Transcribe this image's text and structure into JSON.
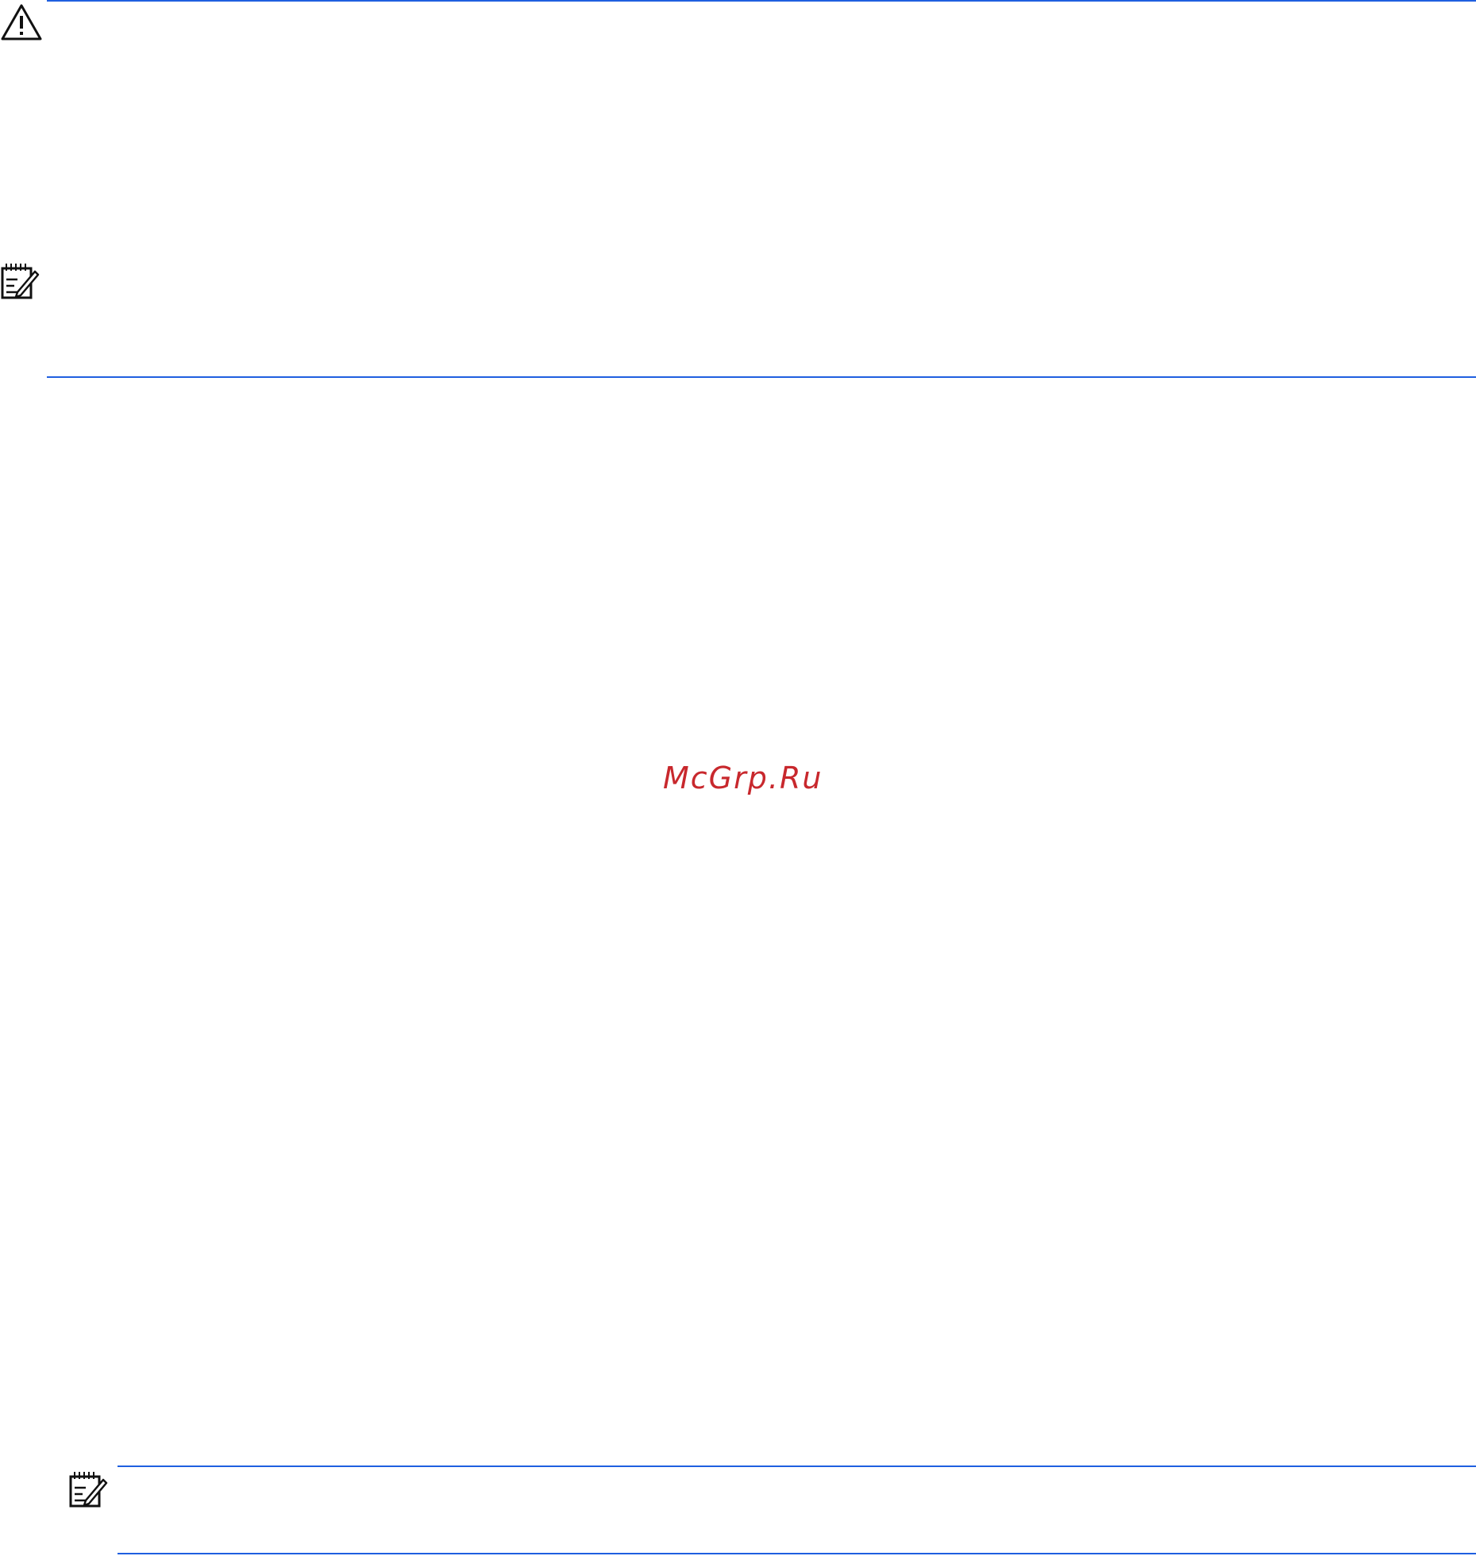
{
  "watermark": {
    "text": "McGrp.Ru"
  },
  "icons": {
    "warning": "warning-triangle-icon",
    "note_top": "note-pencil-icon",
    "note_bottom": "note-pencil-icon"
  },
  "colors": {
    "rule": "#1f5fe0",
    "watermark": "#c8282d",
    "icon": "#111111"
  }
}
